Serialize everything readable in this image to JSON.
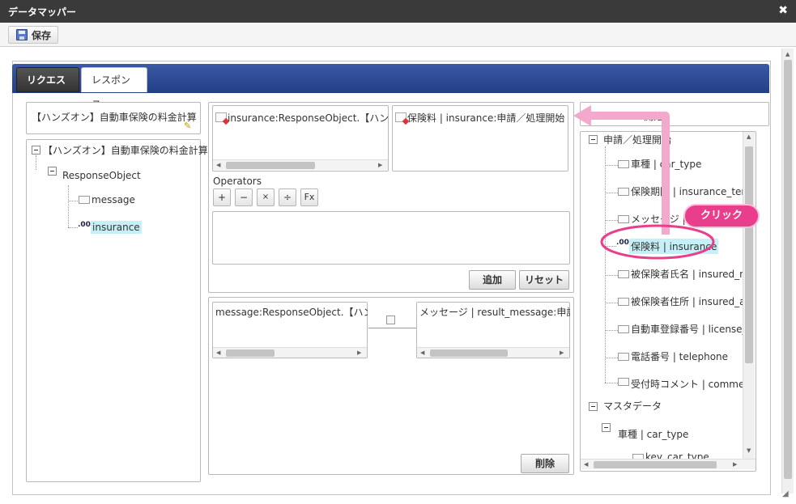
{
  "window": {
    "title": "データマッパー",
    "close_glyph": "✖"
  },
  "toolbar": {
    "save_label": "保存"
  },
  "tabs": [
    {
      "label": "リクエスト"
    },
    {
      "label": "レスポンス"
    }
  ],
  "left": {
    "field_value": "【ハンズオン】自動車保険の料金計算",
    "tree": {
      "root": "【ハンズオン】自動車保険の料金計算",
      "child": "ResponseObject",
      "items": [
        {
          "label": "message"
        },
        {
          "label": "insurance",
          "icon": ".00"
        }
      ]
    }
  },
  "center": {
    "source_box": "insurance:ResponseObject.【ハンズオ",
    "target_box": "保険料 | insurance:申請／処理開始",
    "operators_label": "Operators",
    "operators": [
      "+",
      "−",
      "×",
      "÷",
      "Fx"
    ],
    "add_button": "追加",
    "reset_button": "リセット",
    "mapping": {
      "source": "message:ResponseObject.【ハンズ",
      "target": "メッセージ | result_message:申請／"
    },
    "delete_button": "削除"
  },
  "right": {
    "header": "開始",
    "group1": "申請／処理開始",
    "items": [
      {
        "label": "車種 | car_type"
      },
      {
        "label": "保険期間 | insurance_term"
      },
      {
        "label": "メッセージ |"
      },
      {
        "label": "保険料 | insurance",
        "icon": ".00"
      },
      {
        "label": "被保険者氏名 | insured_n"
      },
      {
        "label": "被保険者住所 | insured_a"
      },
      {
        "label": "自動車登録番号 | license_"
      },
      {
        "label": "電話番号 | telephone"
      },
      {
        "label": "受付時コメント | comment"
      }
    ],
    "group2": "マスタデータ",
    "sub2": "車種 | car_type",
    "sub2_item": "key_car_type"
  },
  "annotation": {
    "label": "クリック",
    "color": "#e83e8c"
  }
}
